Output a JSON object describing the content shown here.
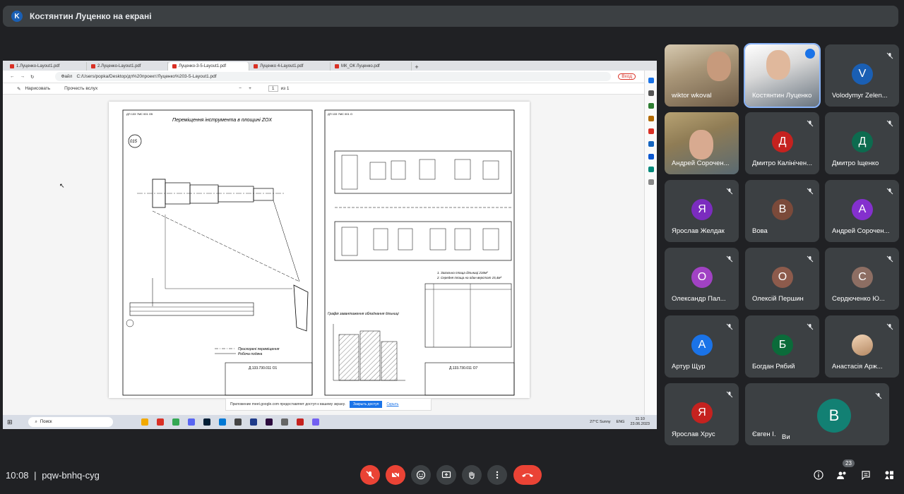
{
  "header": {
    "avatar_letter": "K",
    "title": "Костянтин Луценко на екрані"
  },
  "browser": {
    "tabs": [
      "1.Луценко-Layout1.pdf",
      "2.Луценко-Layout1.pdf",
      "Луценко-3-5-Layout1.pdf",
      "Луценко 4-Layout1.pdf",
      "МК_ОК Луценко.pdf"
    ],
    "url_prefix": "Файл",
    "url": "C:/Users/popka/Desktop/дп%20проект/Луценко%203-5-Layout1.pdf",
    "profile_label": "Вход",
    "toolbar_draw": "Нарисовать",
    "toolbar_read": "Прочесть вслух",
    "page_num": "1",
    "page_total": "из 1"
  },
  "drawing": {
    "left_title": "Переміщення інструмента в площині ZOX",
    "left_code": "ДП 133 7МС 001 О5",
    "right_code": "ДП 133 7МС 001 О",
    "circle_label": "015",
    "legend_fast": "Прискорені переміщення",
    "legend_work": "Робоча подача",
    "stamp_left": "Д.133.730.011 О1",
    "stamp_right": "Д.133.730.011 О7",
    "chart_title": "Графік завантаження обладнання дільниці",
    "note1": "1. Загальна площа дільниці 216м²",
    "note2": "2. Середня площа на один верстат 15,4м²"
  },
  "notification": {
    "text": "Приложение meet.google.com предоставляет доступ к вашему экрану.",
    "stop": "Закрыть доступ",
    "hide": "Скрыть"
  },
  "taskbar": {
    "search": "Поиск",
    "weather": "27°C  Sunny",
    "lang": "ENG",
    "time": "11:10",
    "date": "23.06.2023"
  },
  "participants": [
    {
      "name": "wiktor wkoval",
      "letter": "",
      "color": ""
    },
    {
      "name": "Костянтин Луценко",
      "letter": "",
      "color": ""
    },
    {
      "name": "Volodymyr Zelen...",
      "letter": "V",
      "color": "#1a5fb4"
    },
    {
      "name": "Андрей Сорочен...",
      "letter": "",
      "color": ""
    },
    {
      "name": "Дмитро Калінічен...",
      "letter": "Д",
      "color": "#c5221f"
    },
    {
      "name": "Дмитро Іщенко",
      "letter": "Д",
      "color": "#0d6b4f"
    },
    {
      "name": "Ярослав Желдак",
      "letter": "Я",
      "color": "#7b2cbf"
    },
    {
      "name": "Вова",
      "letter": "В",
      "color": "#7b4a3a"
    },
    {
      "name": "Андрей Сорочен...",
      "letter": "А",
      "color": "#8430ce"
    },
    {
      "name": "Олександр Пал...",
      "letter": "О",
      "color": "#a142c4"
    },
    {
      "name": "Олексій Першин",
      "letter": "О",
      "color": "#8d5b4c"
    },
    {
      "name": "Сердюченко Ю...",
      "letter": "С",
      "color": "#8d6e63"
    },
    {
      "name": "Артур Щур",
      "letter": "А",
      "color": "#1a73e8"
    },
    {
      "name": "Богдан Рябий",
      "letter": "Б",
      "color": "#0b6b3a"
    },
    {
      "name": "Анастасія Арж...",
      "letter": "",
      "color": ""
    },
    {
      "name": "Ярослав Хрус",
      "letter": "Я",
      "color": "#c5221f"
    },
    {
      "name": "Євген І...",
      "letter": "",
      "color": ""
    }
  ],
  "self": {
    "letter": "B",
    "name": "Ви"
  },
  "bottom": {
    "time": "10:08",
    "meeting_code": "pqw-bnhq-cyg",
    "people_count": "23"
  }
}
